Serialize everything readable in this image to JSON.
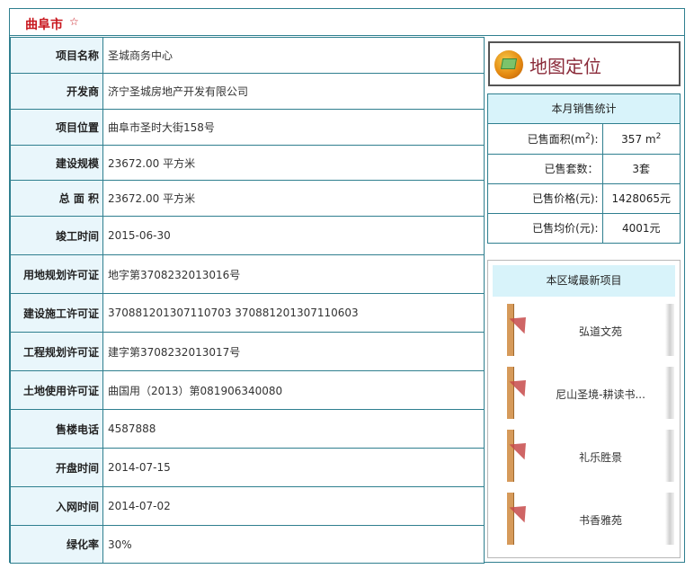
{
  "header": {
    "city": "曲阜市",
    "star": "☆"
  },
  "info_rows": [
    {
      "label": "项目名称",
      "value": "圣城商务中心"
    },
    {
      "label": "开发商",
      "value": "济宁圣城房地产开发有限公司"
    },
    {
      "label": "项目位置",
      "value": "曲阜市圣时大街158号"
    },
    {
      "label": "建设规模",
      "value": "23672.00 平方米"
    },
    {
      "label": "总 面 积",
      "value": "23672.00 平方米"
    },
    {
      "label": "竣工时间",
      "value": "2015-06-30"
    },
    {
      "label": "用地规划许可证",
      "value": "地字第3708232013016号"
    },
    {
      "label": "建设施工许可证",
      "value": "370881201307110703 370881201307110603"
    },
    {
      "label": "工程规划许可证",
      "value": "建字第3708232013017号"
    },
    {
      "label": "土地使用许可证",
      "value": "曲国用（2013）第081906340080"
    },
    {
      "label": "售楼电话",
      "value": "4587888"
    },
    {
      "label": "开盘时间",
      "value": "2014-07-15"
    },
    {
      "label": "入网时间",
      "value": "2014-07-02"
    },
    {
      "label": "绿化率",
      "value": "30%"
    }
  ],
  "map_button": {
    "label": "地图定位",
    "icon": "map-pin-icon"
  },
  "sales": {
    "title": "本月销售统计",
    "area_label": "已售面积(m",
    "area_label_sup": "2",
    "area_label_end": "):",
    "area_value": "357 m",
    "area_value_sup": "2",
    "count_label": "已售套数：",
    "count_value": "3套",
    "price_label": "已售价格(元):",
    "price_value": "1428065元",
    "avg_label": "已售均价(元):",
    "avg_value": "4001元"
  },
  "latest": {
    "title": "本区域最新项目",
    "items": [
      {
        "name": "弘道文苑"
      },
      {
        "name": "尼山圣境-耕读书..."
      },
      {
        "name": "礼乐胜景"
      },
      {
        "name": "书香雅苑"
      }
    ]
  },
  "colors": {
    "accent": "#c8161d",
    "border": "#2f7f8f",
    "label_bg": "#e9f6fb",
    "head_bg": "#d8f3fa"
  }
}
